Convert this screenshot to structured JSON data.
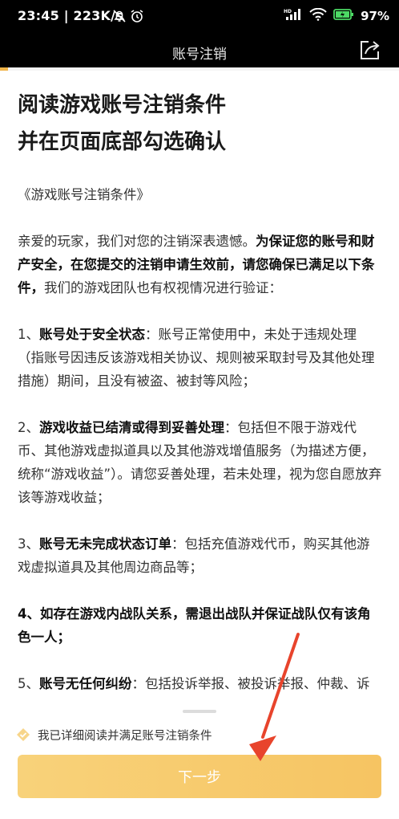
{
  "status_bar": {
    "time_speed": "23:45 | 223K/s",
    "battery": "97%",
    "icons": [
      "mute-bell-icon",
      "alarm-icon",
      "signal-icon",
      "wifi-icon",
      "battery-icon"
    ]
  },
  "header": {
    "title": "账号注销",
    "share_icon": "share-icon"
  },
  "progress": {
    "value": 0.02
  },
  "content": {
    "heading_line1": "阅读游戏账号注销条件",
    "heading_line2": "并在页面底部勾选确认",
    "doc_title": "《游戏账号注销条件》",
    "p1_a": "亲爱的玩家，我们对您的注销深表遗憾。",
    "p1_b": "为保证您的账号和财产安全，在您提交的注销申请生效前，请您确保已满足以下条件，",
    "p1_c": "我们的游戏团队也有权视情况进行验证：",
    "p2_a": "1、",
    "p2_b": "账号处于安全状态",
    "p2_c": "：账号正常使用中，未处于违规处理（指账号因违反该游戏相关协议、规则被采取封号及其他处理措施）期间，且没有被盗、被封等风险；",
    "p3_a": "2、",
    "p3_b": "游戏收益已结清或得到妥善处理",
    "p3_c": "：包括但不限于游戏代币、其他游戏虚拟道具以及其他游戏增值服务（为描述方便，统称“游戏收益”）。请您妥善处理，若未处理，视为您自愿放弃该等游戏收益；",
    "p4_a": "3、",
    "p4_b": "账号无未完成状态订单",
    "p4_c": "：包括充值游戏代币，购买其他游戏虚拟道具及其他周边商品等；",
    "p5": "4、如存在游戏内战队关系，需退出战队并保证战队仅有该角色一人；",
    "p6_a": "5、",
    "p6_b": "账号无任何纠纷",
    "p6_c": "：包括投诉举报、被投诉举报、仲裁、诉讼等纠纷；"
  },
  "footer": {
    "agree_label": "我已详细阅读并满足账号注销条件",
    "next_label": "下一步"
  },
  "colors": {
    "accent": "#f0b44a",
    "button_start": "#f8d27a",
    "button_end": "#f6c462",
    "arrow": "#e8442c"
  }
}
